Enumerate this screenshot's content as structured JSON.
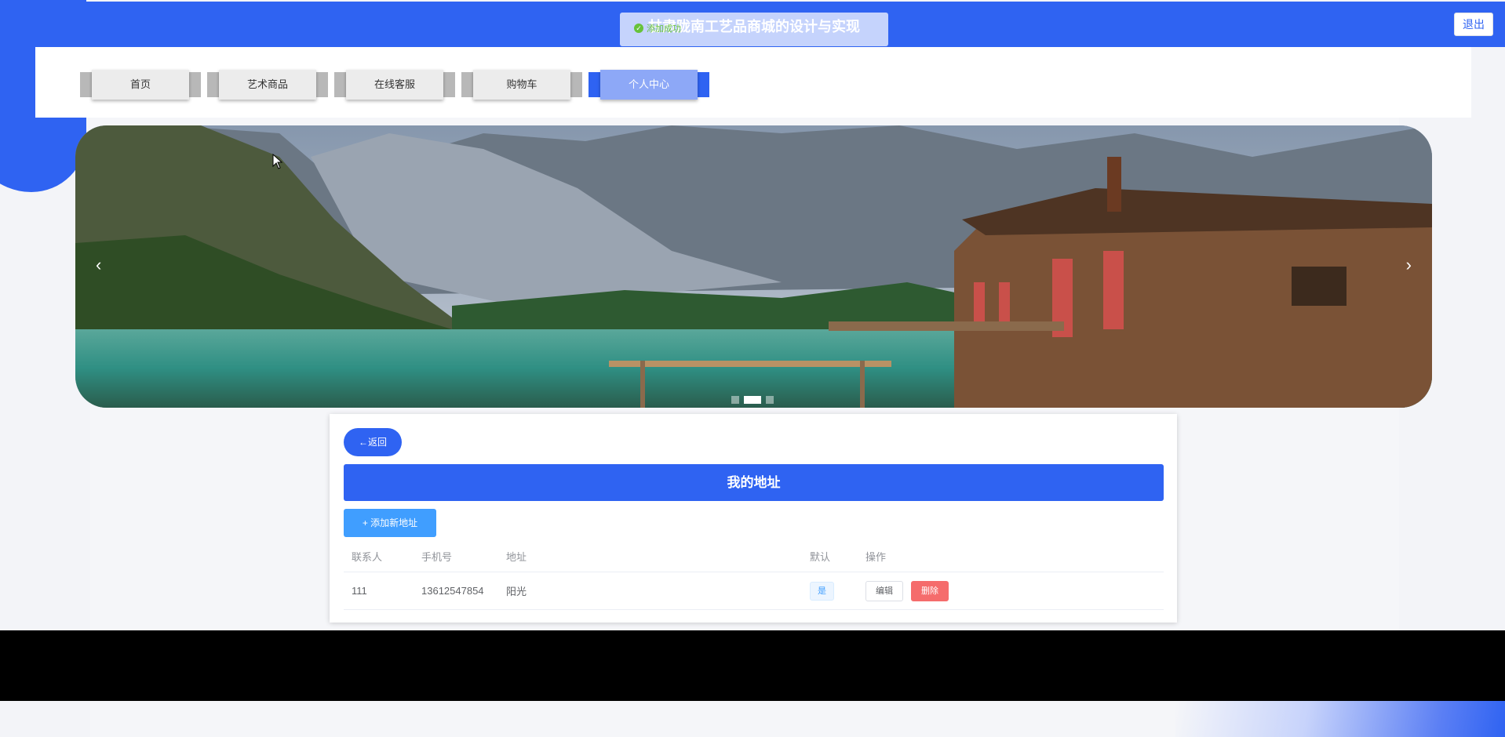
{
  "header": {
    "site_title": "甘肃陇南工艺品商城的设计与实现",
    "toast_text": "添加成功",
    "logout_label": "退出"
  },
  "nav": {
    "items": [
      {
        "label": "首页"
      },
      {
        "label": "艺术商品"
      },
      {
        "label": "在线客服"
      },
      {
        "label": "购物车"
      },
      {
        "label": "个人中心"
      }
    ],
    "active_index": 4
  },
  "banner": {
    "prev_arrow": "‹",
    "next_arrow": "›",
    "slide_count": 3,
    "active_slide": 1
  },
  "address_page": {
    "back_label": "←返回",
    "title": "我的地址",
    "add_label": "+ 添加新地址",
    "columns": {
      "contact": "联系人",
      "phone": "手机号",
      "address": "地址",
      "default": "默认",
      "actions": "操作"
    },
    "rows": [
      {
        "contact": "111",
        "phone": "13612547854",
        "address": "阳光",
        "default": "是",
        "edit_label": "编辑",
        "delete_label": "删除"
      }
    ]
  },
  "colors": {
    "primary": "#2f63f2",
    "add_button": "#409eff",
    "danger": "#f56c6c",
    "success": "#67c23a"
  }
}
